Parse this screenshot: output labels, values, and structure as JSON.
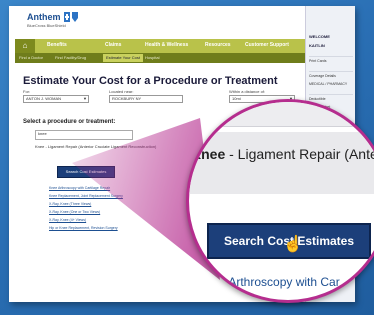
{
  "brand": {
    "logo_text": "Anthem",
    "tagline": "BlueCross BlueShield"
  },
  "nav": {
    "home_icon": "home-icon",
    "items": [
      "Benefits",
      "Claims",
      "Health & Wellness",
      "Resources",
      "Customer Support"
    ]
  },
  "subnav": {
    "items": [
      "Find a Doctor",
      "Find Facility/Drug",
      "Estimate Your Cost",
      "Hospital"
    ]
  },
  "page": {
    "title": "Estimate Your Cost for a Procedure or Treatment",
    "for_label": "For:",
    "for_value": "ANTON J. WOMAN",
    "located_label": "Located near:",
    "located_value": "ROCKBURY NY",
    "within_label": "Within a distance of:",
    "within_value": "10mi",
    "section_label": "Select a procedure or treatment:",
    "search_value": "knee",
    "suggestion": "Knee - Ligament Repair (Anterior Cruciate Ligament Reconstruction)",
    "button_label": "Search Cost Estimates",
    "links": [
      "Knee Arthroscopy with Cartilage Repair",
      "Knee Replacement, Joint Replacement Surgery",
      "X-Ray, Knee (Three Views)",
      "X-Ray, Knee (One or Two Views)",
      "X-Ray, Knee (4+ Views)",
      "Hip or Knee Replacement, Revision Surgery"
    ]
  },
  "sidebar": {
    "welcome": "WELCOME",
    "user": "KAITLIN",
    "lines": [
      "Print Cards",
      "Coverage Details",
      "MEDICAL / PHARMACY",
      "Deductible",
      "Out of Pocket"
    ]
  },
  "magnified": {
    "search_text": "nee",
    "option_bold": "Knee",
    "option_rest": " - Ligament Repair (Ante",
    "button_label": "Search Cost Estimates",
    "link_text": "e Arthroscopy with Car"
  },
  "colors": {
    "navy": "#1c3f7a",
    "olive": "#b9c24a",
    "magenta": "#b52d8e",
    "background": "#2a6fb4"
  }
}
